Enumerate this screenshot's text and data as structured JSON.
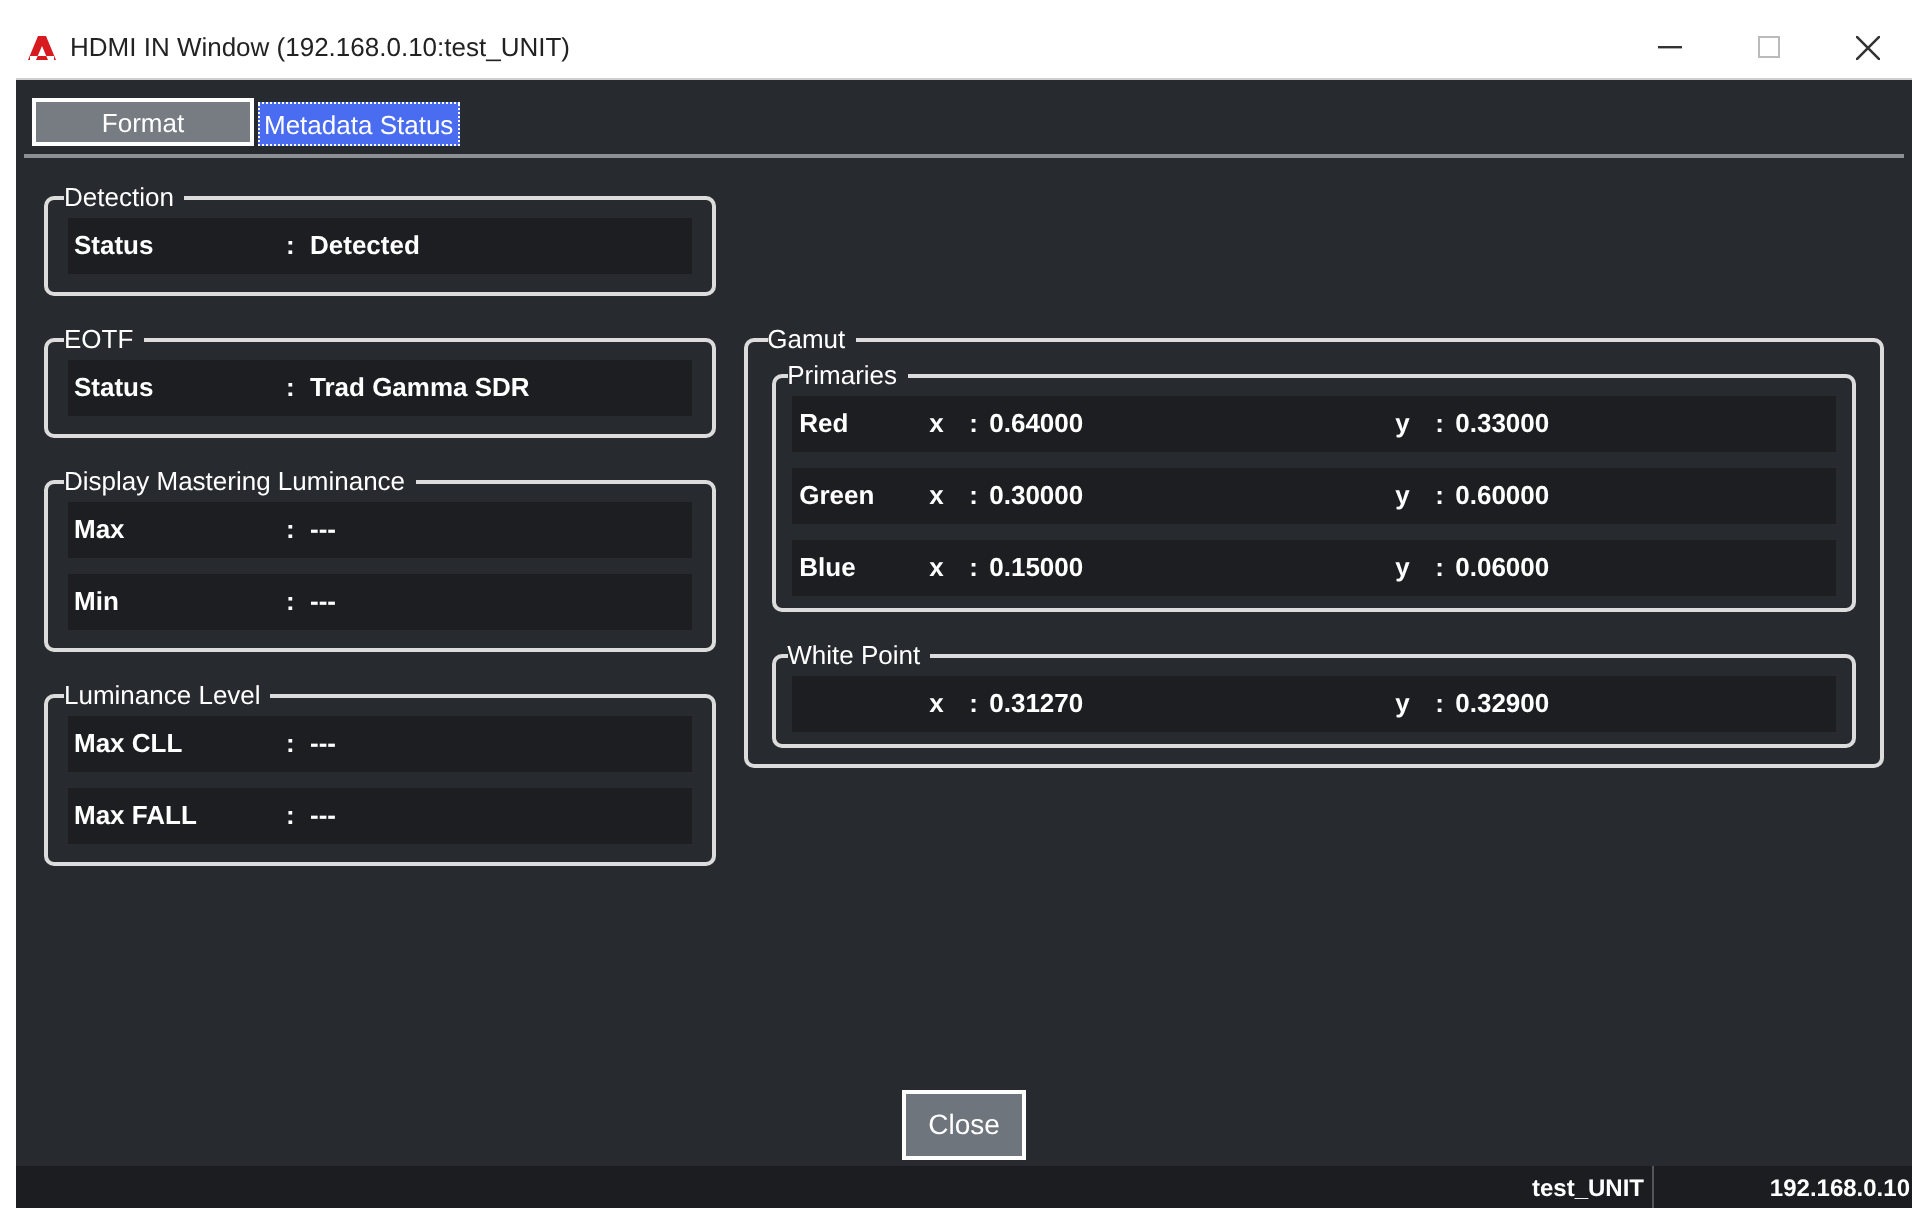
{
  "window": {
    "title": "HDMI IN Window (192.168.0.10:test_UNIT)"
  },
  "tabs": [
    {
      "label": "Format",
      "selected": false
    },
    {
      "label": "Metadata Status",
      "selected": true
    }
  ],
  "left_groups": [
    {
      "title": "Detection",
      "rows": [
        {
          "label": "Status",
          "sep": ":",
          "value": "Detected"
        }
      ]
    },
    {
      "title": "EOTF",
      "rows": [
        {
          "label": "Status",
          "sep": ":",
          "value": "Trad Gamma SDR"
        }
      ]
    },
    {
      "title": "Display Mastering Luminance",
      "rows": [
        {
          "label": "Max",
          "sep": ":",
          "value": "---"
        },
        {
          "label": "Min",
          "sep": ":",
          "value": "---"
        }
      ]
    },
    {
      "title": "Luminance Level",
      "rows": [
        {
          "label": "Max CLL",
          "sep": ":",
          "value": "---"
        },
        {
          "label": "Max FALL",
          "sep": ":",
          "value": "---"
        }
      ]
    }
  ],
  "gamut": {
    "title": "Gamut",
    "groups": [
      {
        "title": "Primaries",
        "rows": [
          {
            "label": "Red",
            "x_label": "x",
            "x_sep": ":",
            "x_value": "0.64000",
            "y_label": "y",
            "y_sep": ":",
            "y_value": "0.33000"
          },
          {
            "label": "Green",
            "x_label": "x",
            "x_sep": ":",
            "x_value": "0.30000",
            "y_label": "y",
            "y_sep": ":",
            "y_value": "0.60000"
          },
          {
            "label": "Blue",
            "x_label": "x",
            "x_sep": ":",
            "x_value": "0.15000",
            "y_label": "y",
            "y_sep": ":",
            "y_value": "0.06000"
          }
        ]
      },
      {
        "title": "White Point",
        "rows": [
          {
            "x_label": "x",
            "x_sep": ":",
            "x_value": "0.31270",
            "y_label": "y",
            "y_sep": ":",
            "y_value": "0.32900"
          }
        ]
      }
    ]
  },
  "buttons": [
    {
      "label": "Close"
    }
  ],
  "status_bar": {
    "unit": "test_UNIT",
    "address": "192.168.0.10"
  }
}
